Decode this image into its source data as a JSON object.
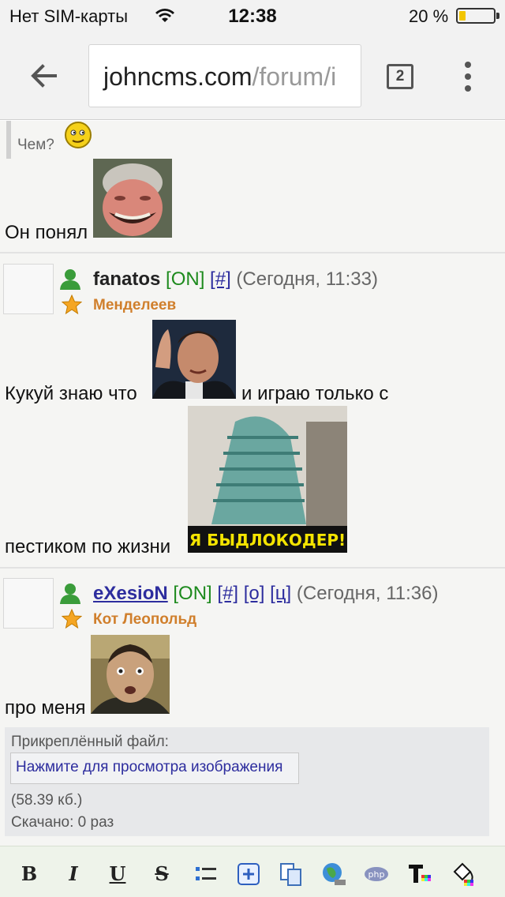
{
  "status_bar": {
    "carrier": "Нет SIM-карты",
    "time": "12:38",
    "battery_percent": "20 %",
    "battery_level": 0.2
  },
  "browser": {
    "url_host": "johncms.com",
    "url_path": "/forum/i",
    "tab_count": "2",
    "icons": [
      "arrow-left-icon",
      "tabs-icon",
      "more-vert-icon"
    ]
  },
  "posts": [
    {
      "quote_text": "Чем?",
      "text": "Он понял"
    },
    {
      "nick": "fanatos",
      "online": "[ON]",
      "links": [
        "[#]"
      ],
      "date": "(Сегодня, 11:33)",
      "status": "Менделеев",
      "text_line1": "Кукуй знаю что",
      "text_line1b": "и играю только с",
      "text_line2": "пестиком по жизни",
      "image_caption": "Я БЫДЛОКОДЕР!"
    },
    {
      "nick": "eXesioN",
      "online": "[ON]",
      "links": [
        "[#]",
        "[о]",
        "[ц]"
      ],
      "date": "(Сегодня, 11:36)",
      "status": "Кот Леопольд",
      "text": "про меня",
      "attachment": {
        "label": "Прикреплённый файл:",
        "view_button": "Нажмите для просмотра изображения",
        "size": "(58.39 кб.)",
        "downloads": "Скачано: 0 раз"
      }
    }
  ],
  "bbcode_toolbar": {
    "bold": "B",
    "italic": "I",
    "underline": "U",
    "strike": "S"
  },
  "colors": {
    "online": "#1d8a1d",
    "link": "#2d2d9e",
    "status": "#d07f2c",
    "battery": "#f2c500"
  }
}
